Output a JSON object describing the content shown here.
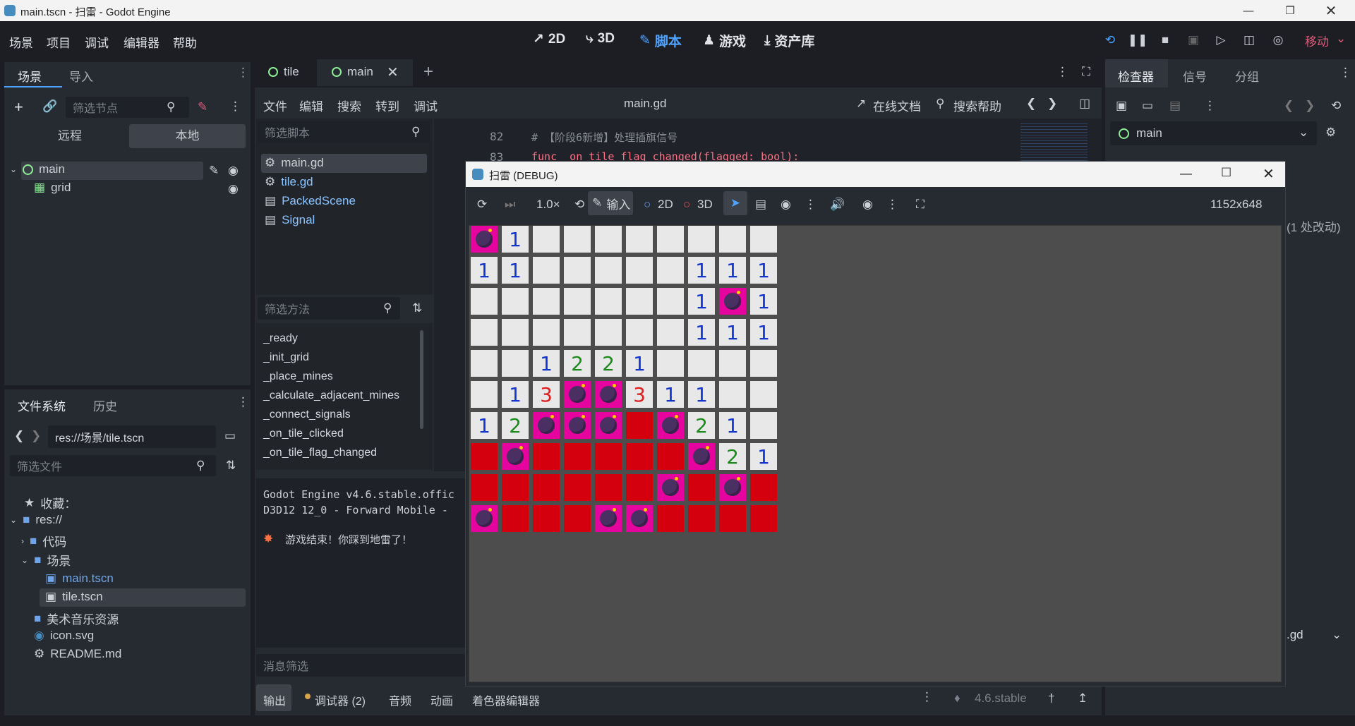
{
  "window": {
    "title": "main.tscn - 扫雷 - Godot Engine"
  },
  "menu": [
    "场景",
    "项目",
    "调试",
    "编辑器",
    "帮助"
  ],
  "workspaces": [
    {
      "label": "2D",
      "icon": "2d-icon"
    },
    {
      "label": "3D",
      "icon": "3d-icon"
    },
    {
      "label": "脚本",
      "icon": "script-icon"
    },
    {
      "label": "游戏",
      "icon": "game-icon"
    },
    {
      "label": "资产库",
      "icon": "assetlib-icon"
    }
  ],
  "renderer": "移动",
  "scene_dock": {
    "tabs": [
      "场景",
      "导入"
    ],
    "filter_placeholder": "筛选节点",
    "remote": "远程",
    "local": "本地",
    "nodes": [
      "main",
      "grid"
    ]
  },
  "filesystem_dock": {
    "tabs": [
      "文件系统",
      "历史"
    ],
    "path": "res://场景/tile.tscn",
    "filter_placeholder": "筛选文件",
    "items": [
      "收藏：",
      "res://",
      "代码",
      "场景",
      "main.tscn",
      "tile.tscn",
      "美术音乐资源",
      "icon.svg",
      "README.md"
    ]
  },
  "editor_tabs": [
    "tile",
    "main"
  ],
  "script_menu": [
    "文件",
    "编辑",
    "搜索",
    "转到",
    "调试"
  ],
  "script_title": "main.gd",
  "online_docs": "在线文档",
  "search_help": "搜索帮助",
  "script_filter_placeholder": "筛选脚本",
  "scripts": [
    "main.gd",
    "tile.gd",
    "PackedScene",
    "Signal"
  ],
  "method_filter_placeholder": "筛选方法",
  "methods": [
    "_ready",
    "_init_grid",
    "_place_mines",
    "_calculate_adjacent_mines",
    "_connect_signals",
    "_on_tile_clicked",
    "_on_tile_flag_changed"
  ],
  "code": {
    "line82_num": "82",
    "line82": "# 【阶段6新增】处理插旗信号",
    "line83_num": "83",
    "line83": "func _on_tile_flag_changed(flagged: bool):"
  },
  "output": {
    "line1": "Godot Engine v4.6.stable.offic",
    "line2": "D3D12 12_0 - Forward Mobile -",
    "line3": "游戏结束！你踩到地雷了！",
    "filter_placeholder": "消息筛选"
  },
  "bottom_tabs": [
    "输出",
    "调试器 (2)",
    "音频",
    "动画",
    "着色器编辑器"
  ],
  "version": "4.6.stable",
  "inspector": {
    "tabs": [
      "检查器",
      "信号",
      "分组"
    ],
    "node": "main",
    "changes": "(1 处改动)",
    "script_suffix": ".gd"
  },
  "debug_window": {
    "title": "扫雷 (DEBUG)",
    "speed": "1.0×",
    "input": "输入",
    "mode2d": "2D",
    "mode3d": "3D",
    "resolution": "1152x648"
  },
  "board": {
    "legend": "h = revealed/hidden light tile, r = red revealed, b = mine (magenta); digits = adjacent mine count",
    "rows": [
      [
        "b",
        "1",
        "h",
        "h",
        "h",
        "h",
        "h",
        "h",
        "h",
        "h"
      ],
      [
        "1",
        "1",
        "h",
        "h",
        "h",
        "h",
        "h",
        "1",
        "1",
        "1"
      ],
      [
        "h",
        "h",
        "h",
        "h",
        "h",
        "h",
        "h",
        "1",
        "b",
        "1"
      ],
      [
        "h",
        "h",
        "h",
        "h",
        "h",
        "h",
        "h",
        "1",
        "1",
        "1"
      ],
      [
        "h",
        "h",
        "1",
        "2",
        "2",
        "1",
        "h",
        "h",
        "h",
        "h"
      ],
      [
        "h",
        "1",
        "3",
        "b",
        "b",
        "3",
        "1",
        "1",
        "h",
        "h"
      ],
      [
        "1",
        "2",
        "b",
        "b",
        "b",
        "r",
        "b",
        "2",
        "1",
        "h"
      ],
      [
        "r",
        "b",
        "r",
        "r",
        "r",
        "r",
        "r",
        "b",
        "2",
        "1"
      ],
      [
        "r",
        "r",
        "r",
        "r",
        "r",
        "r",
        "b",
        "r",
        "b",
        "r"
      ],
      [
        "b",
        "r",
        "r",
        "r",
        "b",
        "b",
        "r",
        "r",
        "r",
        "r"
      ]
    ]
  }
}
